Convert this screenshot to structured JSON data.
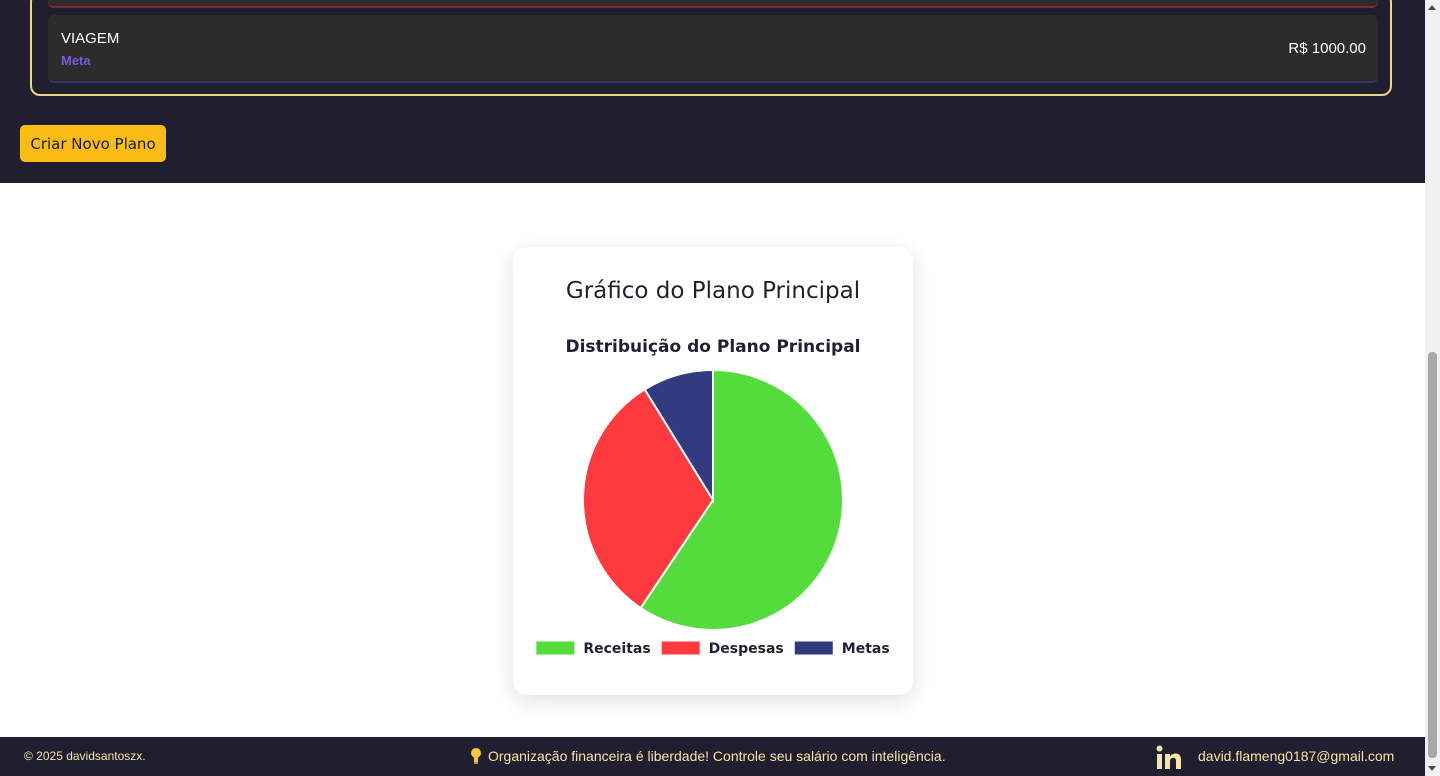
{
  "plan_items": {
    "item": {
      "name": "VIAGEM",
      "type": "Meta",
      "value": "R$ 1000.00"
    }
  },
  "actions": {
    "create_plan_label": "Criar Novo Plano"
  },
  "chart_card": {
    "title": "Gráfico do Plano Principal"
  },
  "chart_data": {
    "type": "pie",
    "title": "Distribuição do Plano Principal",
    "labels": [
      "Receitas",
      "Despesas",
      "Metas"
    ],
    "values": [
      59.4,
      31.8,
      8.8
    ],
    "colors": [
      "#54db3c",
      "#fe3a3e",
      "#303b80"
    ],
    "legend_position": "bottom"
  },
  "footer": {
    "copyright": "© 2025 davidsantoszx.",
    "message": "Organização financeira é liberdade! Controle seu salário com inteligência.",
    "email": "david.flameng0187@gmail.com",
    "icons": [
      "bulb-icon",
      "linkedin-icon"
    ]
  }
}
